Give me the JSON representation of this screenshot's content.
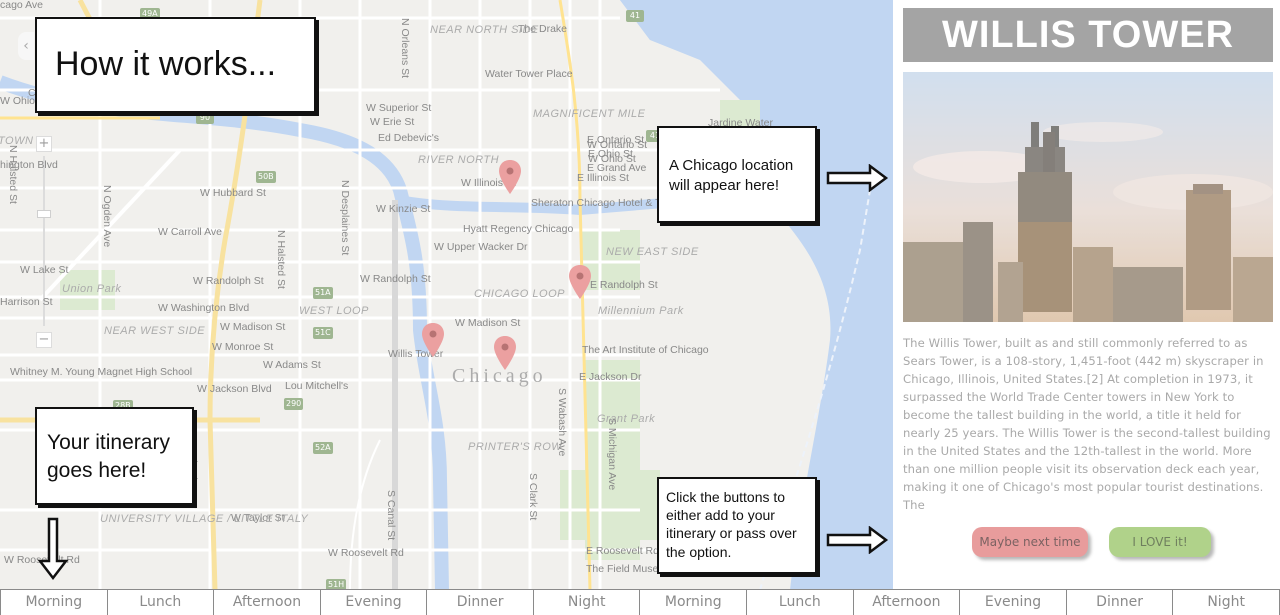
{
  "map": {
    "city_label": "Chicago",
    "labels": [
      {
        "text": "Chicago Ave",
        "cls": ""
      },
      {
        "text": "W Superior St",
        "cls": ""
      },
      {
        "text": "W Erie St",
        "cls": ""
      },
      {
        "text": "W Ontario St",
        "cls": ""
      },
      {
        "text": "W Ohio St",
        "cls": ""
      },
      {
        "text": "W Hubbard St",
        "cls": ""
      },
      {
        "text": "W Kinzie St",
        "cls": ""
      },
      {
        "text": "W Illinois St",
        "cls": ""
      },
      {
        "text": "W Carroll Ave",
        "cls": ""
      },
      {
        "text": "W Lake St",
        "cls": ""
      },
      {
        "text": "W Randolph St",
        "cls": ""
      },
      {
        "text": "W Randolph St",
        "cls": ""
      },
      {
        "text": "W Washington Blvd",
        "cls": ""
      },
      {
        "text": "W Madison St",
        "cls": ""
      },
      {
        "text": "W Madison St",
        "cls": ""
      },
      {
        "text": "W Monroe St",
        "cls": ""
      },
      {
        "text": "W Adams St",
        "cls": ""
      },
      {
        "text": "W Jackson Blvd",
        "cls": ""
      },
      {
        "text": "W Taylor St",
        "cls": ""
      },
      {
        "text": "W Roosevelt Rd",
        "cls": ""
      },
      {
        "text": "W Roosevelt Rd",
        "cls": ""
      },
      {
        "text": "E Ontario St",
        "cls": ""
      },
      {
        "text": "E Ohio St",
        "cls": ""
      },
      {
        "text": "E Grand Ave",
        "cls": ""
      },
      {
        "text": "E Illinois St",
        "cls": ""
      },
      {
        "text": "E Randolph St",
        "cls": ""
      },
      {
        "text": "E Jackson Dr",
        "cls": ""
      },
      {
        "text": "E Roosevelt Rd",
        "cls": ""
      },
      {
        "text": "The Drake",
        "cls": ""
      },
      {
        "text": "Water Tower Place",
        "cls": ""
      },
      {
        "text": "Jardine Water",
        "cls": ""
      },
      {
        "text": "Ed Debevic's",
        "cls": ""
      },
      {
        "text": "Sheraton Chicago Hotel & Towers",
        "cls": ""
      },
      {
        "text": "Hyatt Regency Chicago",
        "cls": ""
      },
      {
        "text": "W Upper Wacker Dr",
        "cls": ""
      },
      {
        "text": "Willis Tower",
        "cls": ""
      },
      {
        "text": "The Art Institute of Chicago",
        "cls": ""
      },
      {
        "text": "Lou Mitchell's",
        "cls": ""
      },
      {
        "text": "The Field Museum",
        "cls": ""
      },
      {
        "text": "Whitney M. Young Magnet High School",
        "cls": ""
      },
      {
        "text": "Union Park",
        "cls": "area"
      },
      {
        "text": "Millennium Park",
        "cls": "area"
      },
      {
        "text": "Grant Park",
        "cls": "area"
      },
      {
        "text": "NEAR NORTH SIDE",
        "cls": "area"
      },
      {
        "text": "MAGNIFICENT MILE",
        "cls": "area"
      },
      {
        "text": "RIVER NORTH",
        "cls": "area"
      },
      {
        "text": "NEW EAST SIDE",
        "cls": "area"
      },
      {
        "text": "CHICAGO LOOP",
        "cls": "area"
      },
      {
        "text": "WEST LOOP",
        "cls": "area"
      },
      {
        "text": "NEAR WEST SIDE",
        "cls": "area"
      },
      {
        "text": "PRINTER'S ROW",
        "cls": "area"
      },
      {
        "text": "UNIVERSITY VILLAGE / LITTLE ITALY",
        "cls": "area"
      },
      {
        "text": "TOWN",
        "cls": "area"
      },
      {
        "text": "N Orleans St",
        "cls": "vert"
      },
      {
        "text": "N Halsted St",
        "cls": "vert"
      },
      {
        "text": "N Halsted St",
        "cls": "vert"
      },
      {
        "text": "N Desplaines St",
        "cls": "vert"
      },
      {
        "text": "N Ogden Ave",
        "cls": "vert"
      },
      {
        "text": "S Canal St",
        "cls": "vert"
      },
      {
        "text": "S Clark St",
        "cls": "vert"
      },
      {
        "text": "S Wabash Ave",
        "cls": "vert"
      },
      {
        "text": "S Michigan Ave",
        "cls": "vert"
      },
      {
        "text": "S Columbus Dr",
        "cls": "vert"
      },
      {
        "text": "Harrison St",
        "cls": ""
      },
      {
        "text": "hington Blvd",
        "cls": ""
      },
      {
        "text": "W Ohio St",
        "cls": ""
      },
      {
        "text": "cago Ave",
        "cls": ""
      }
    ],
    "highway_shields": [
      "41",
      "41",
      "90",
      "290",
      "50B",
      "51A",
      "51C",
      "52A",
      "51H",
      "28B",
      "49A"
    ]
  },
  "callouts": {
    "how": "How it works...",
    "location": "A Chicago location will appear here!",
    "itinerary": "Your itinerary goes here!",
    "buttons": "Click the buttons to either add to your itinerary or pass over the option."
  },
  "panel": {
    "title": "WILLIS TOWER",
    "description": "The Willis Tower, built as and still commonly referred to as Sears Tower, is a 108-story, 1,451-foot (442 m) skyscraper in Chicago, Illinois, United States.[2] At completion in 1973, it surpassed the World Trade Center towers in New York to become the tallest building in the world, a title it held for nearly 25 years. The Willis Tower is the second-tallest building in the United States and the 12th-tallest in the world. More than one million people visit its observation deck each year, making it one of Chicago's most popular tourist destinations. The",
    "maybe_label": "Maybe next time",
    "love_label": "I LOVE it!",
    "maybe_color": "#e89c9c",
    "love_color": "#b0d28a"
  },
  "slots": [
    "Morning",
    "Lunch",
    "Afternoon",
    "Evening",
    "Dinner",
    "Night",
    "Morning",
    "Lunch",
    "Afternoon",
    "Evening",
    "Dinner",
    "Night"
  ]
}
